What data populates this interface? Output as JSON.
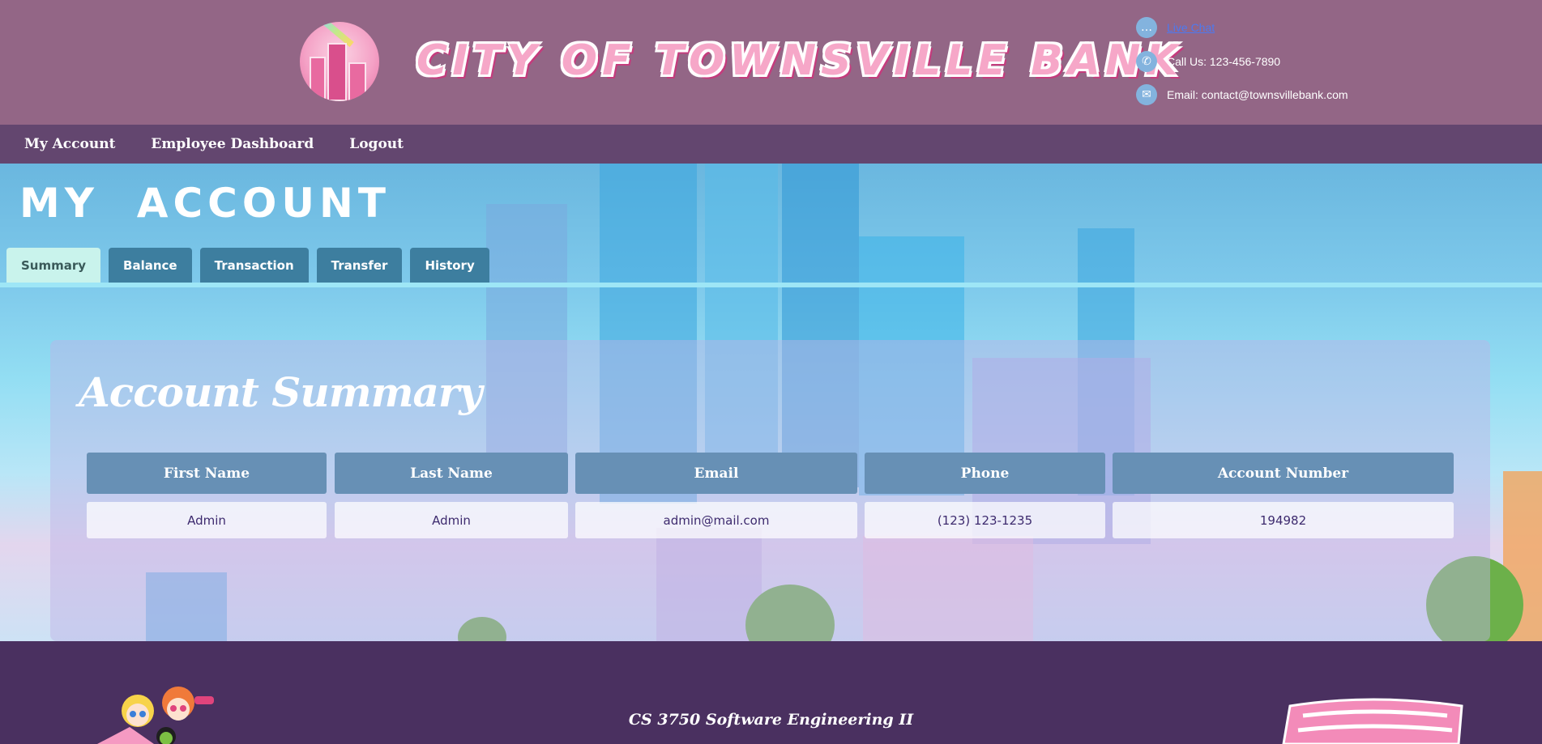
{
  "header": {
    "bank_title": "City of Townsville Bank",
    "contact": {
      "live_chat": "Live Chat",
      "phone": "Call Us: 123-456-7890",
      "email": "Email: contact@townsvillebank.com"
    }
  },
  "nav": {
    "items": [
      "My Account",
      "Employee Dashboard",
      "Logout"
    ]
  },
  "page": {
    "heading": "MY  ACCOUNT",
    "tabs": [
      "Summary",
      "Balance",
      "Transaction",
      "Transfer",
      "History"
    ],
    "active_tab": "Summary"
  },
  "summary": {
    "title": "Account Summary",
    "headers": [
      "First Name",
      "Last Name",
      "Email",
      "Phone",
      "Account Number"
    ],
    "row": [
      "Admin",
      "Admin",
      "admin@mail.com",
      "(123) 123-1235",
      "194982"
    ]
  },
  "footer": {
    "course": "CS 3750 Software Engineering II"
  },
  "colors": {
    "header_bg": "#936686",
    "nav_bg": "#63466f",
    "tab_bg": "#3d7e9f",
    "tab_active_bg": "#c9f3ec",
    "table_header_bg": "#6790b5",
    "footer_bg": "#4a3060",
    "title_pink": "#f6a7c8"
  },
  "icons": {
    "chat": "chat-bubble-icon",
    "phone": "phone-icon",
    "email": "envelope-icon"
  }
}
